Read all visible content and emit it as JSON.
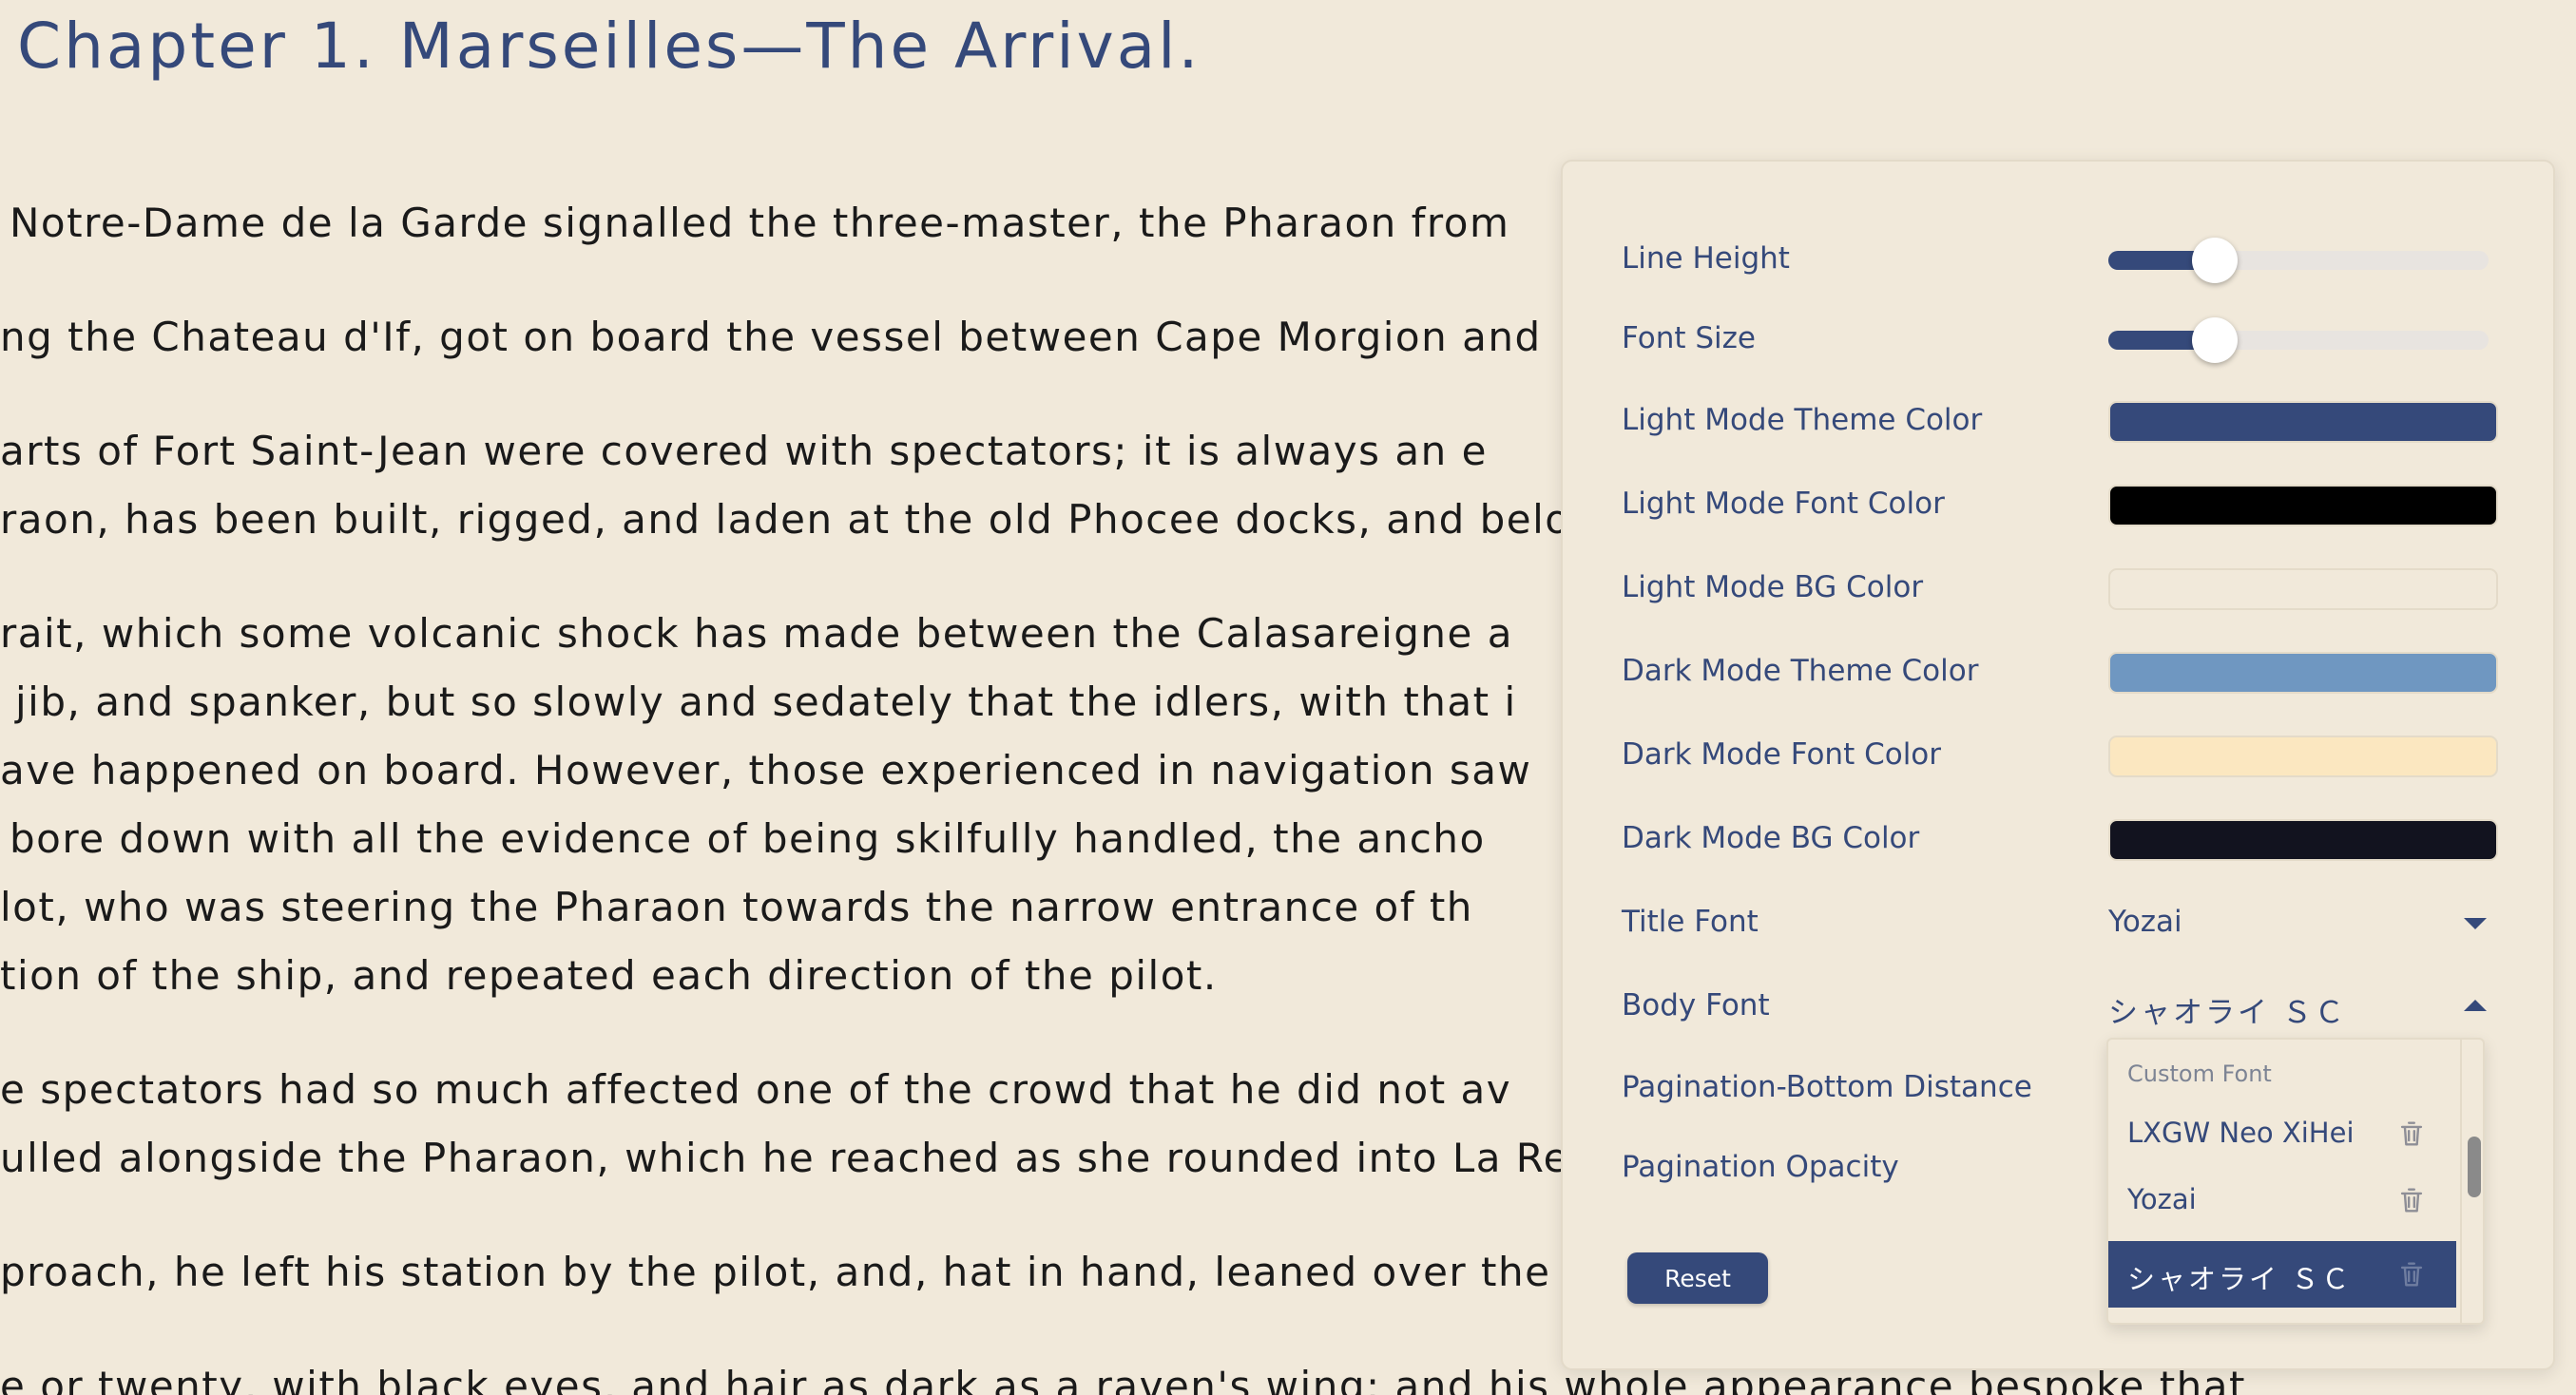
{
  "reader": {
    "chapter_title": "Chapter 1. Marseilles—The Arrival.",
    "lines": [
      "Notre-Dame de la Garde signalled the three-master, the Pharaon from",
      "ng the Chateau d'If, got on board the vessel between Cape Morgion and",
      "arts of Fort Saint-Jean were covered with spectators; it is always an e",
      "raon, has been built, rigged, and laden at the old Phocee docks, and belo",
      "rait, which some volcanic shock has made between the Calasareigne a",
      "jib, and spanker, but so slowly and sedately that the idlers, with that i",
      "ave happened on board. However, those experienced in navigation saw",
      "bore down with all the evidence of being skilfully handled, the ancho",
      "lot, who was steering the Pharaon towards the narrow entrance of th",
      "tion of the ship, and repeated each direction of the pilot.",
      "e spectators had so much affected one of the crowd that he did not av",
      "ulled alongside the Pharaon, which he reached as she rounded into La Re",
      "proach, he left his station by the pilot, and, hat in hand, leaned over the",
      "e or twenty, with black eyes, and hair as dark as a raven's wing; and his whole appearance bespoke that"
    ]
  },
  "settings": {
    "line_height": {
      "label": "Line Height",
      "fraction": 0.28
    },
    "font_size": {
      "label": "Font Size",
      "fraction": 0.28
    },
    "colors": [
      {
        "label": "Light Mode Theme Color",
        "value": "#35497a"
      },
      {
        "label": "Light Mode Font Color",
        "value": "#000000"
      },
      {
        "label": "Light Mode BG Color",
        "value": "#f1e9da"
      },
      {
        "label": "Dark Mode Theme Color",
        "value": "#6f97c1"
      },
      {
        "label": "Dark Mode Font Color",
        "value": "#fbe7c0"
      },
      {
        "label": "Dark Mode BG Color",
        "value": "#12131f"
      }
    ],
    "title_font": {
      "label": "Title Font",
      "value": "Yozai"
    },
    "body_font": {
      "label": "Body Font",
      "value": "シャオライ ＳＣ"
    },
    "pagination_bottom": {
      "label": "Pagination-Bottom Distance"
    },
    "pagination_opacity": {
      "label": "Pagination Opacity"
    },
    "reset_label": "Reset"
  },
  "font_dropdown": {
    "group_label": "Custom Font",
    "options": [
      {
        "label": "LXGW Neo XiHei",
        "selected": false
      },
      {
        "label": "Yozai",
        "selected": false
      },
      {
        "label": "シャオライ ＳＣ",
        "selected": true
      }
    ]
  }
}
